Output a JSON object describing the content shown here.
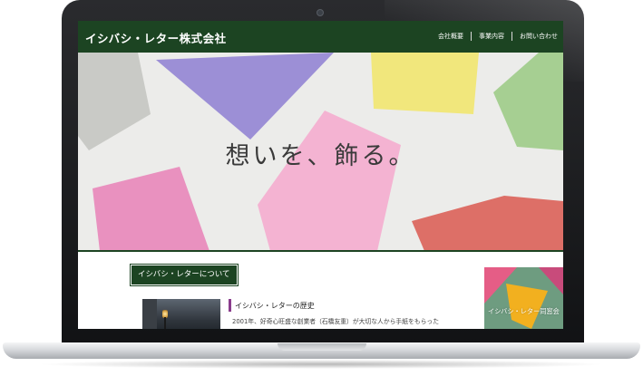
{
  "site": {
    "logo": "イシバシ・レター株式会社",
    "nav": [
      "会社概要",
      "事業内容",
      "お問い合わせ"
    ]
  },
  "hero": {
    "tagline": "想いを、飾る。"
  },
  "about": {
    "heading": "イシバシ・レターについて"
  },
  "history": {
    "title": "イシバシ・レターの歴史",
    "text": "2001年、好奇心旺盛な創業者（石橋友重）が大切な人から手紙をもらった"
  },
  "banner": {
    "label": "イシバシ・レター同窓会"
  },
  "colors": {
    "brand_green": "#1c4422",
    "accent_purple": "#8a3c8c",
    "envelope_gray": "#c9cac6",
    "envelope_purple": "#9c8fd6",
    "envelope_yellow": "#f1e77c",
    "envelope_green": "#a6cf92",
    "envelope_pink": "#f4b3d2",
    "envelope_rose": "#e991bf",
    "envelope_red": "#dd6f67"
  }
}
